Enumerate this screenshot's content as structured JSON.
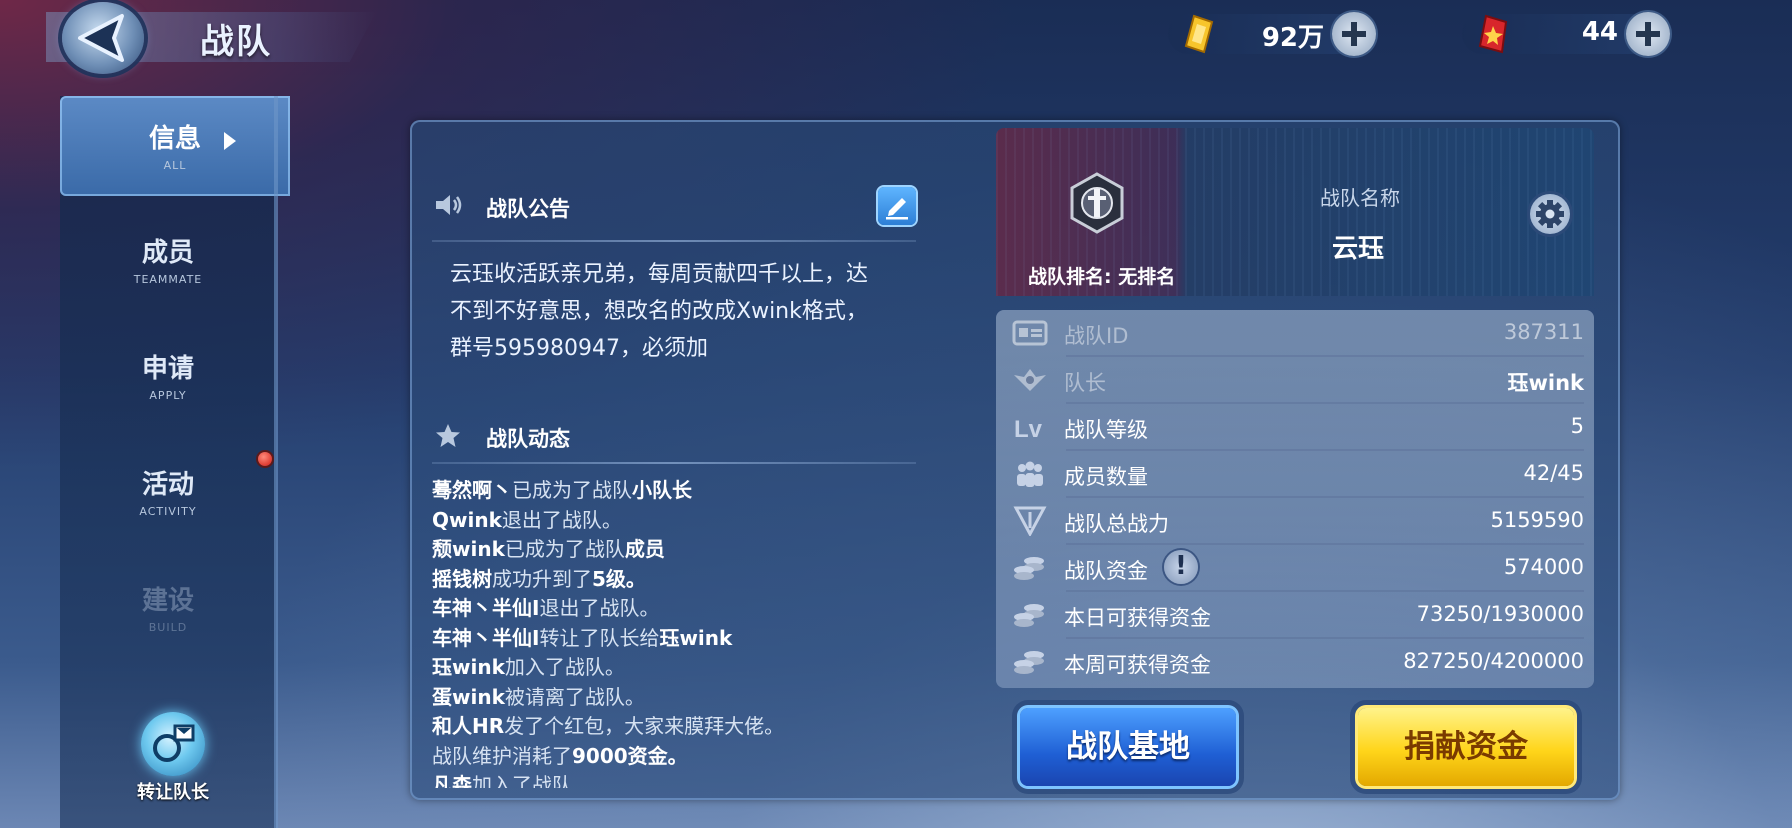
{
  "header": {
    "title": "战队"
  },
  "currencies": {
    "gold": "92万",
    "gems": "44"
  },
  "sidebar": {
    "items": [
      {
        "label": "信息",
        "sub": "ALL"
      },
      {
        "label": "成员",
        "sub": "TEAMMATE"
      },
      {
        "label": "申请",
        "sub": "APPLY"
      },
      {
        "label": "活动",
        "sub": "ACTIVITY"
      },
      {
        "label": "建设",
        "sub": "BUILD"
      }
    ],
    "transfer_label": "转让队长"
  },
  "notice": {
    "title": "战队公告",
    "lines": [
      "云珏收活跃亲兄弟，每周贡献四千以上，达",
      "不到不好意思，想改名的改成Xwink格式，",
      "群号595980947，必须加"
    ]
  },
  "feed": {
    "title": "战队动态",
    "rows": [
      {
        "name": "蓦然啊丶",
        "text": "已成为了战队",
        "extra": "小队长"
      },
      {
        "name": "Qwink",
        "text": "退出了战队。",
        "extra": ""
      },
      {
        "name": "颓wink",
        "text": "已成为了战队",
        "extra": "成员"
      },
      {
        "name": "摇钱树",
        "text": "成功升到了",
        "extra": "5级。"
      },
      {
        "name": "车神丶半仙I",
        "text": "退出了战队。",
        "extra": ""
      },
      {
        "name": "车神丶半仙I",
        "text": "转让了队长给",
        "extra": "珏wink"
      },
      {
        "name": "珏wink",
        "text": "加入了战队。",
        "extra": ""
      },
      {
        "name": "蛋wink",
        "text": "被请离了战队。",
        "extra": ""
      },
      {
        "name": "和人HR",
        "text": "发了个红包，大家来膜拜大佬。",
        "extra": ""
      },
      {
        "name": "",
        "text": "战队维护消耗了",
        "extra": "9000资金。"
      },
      {
        "name": "凡森",
        "text": "加入了战队",
        "extra": ""
      }
    ]
  },
  "team": {
    "rank_label": "战队排名:",
    "rank_value": "无排名",
    "name_label": "战队名称",
    "name": "云珏"
  },
  "stats": [
    {
      "icon": "id-card-icon",
      "label": "战队ID",
      "value": "387311",
      "style": "dim"
    },
    {
      "icon": "captain-wings-icon",
      "label": "队长",
      "value": "珏wink",
      "style": "dim"
    },
    {
      "icon": "level-icon",
      "label": "战队等级",
      "value": "5",
      "style": "bright"
    },
    {
      "icon": "members-icon",
      "label": "成员数量",
      "value": "42/45",
      "style": "bright"
    },
    {
      "icon": "power-icon",
      "label": "战队总战力",
      "value": "5159590",
      "style": "bright"
    },
    {
      "icon": "coins-icon",
      "label": "战队资金",
      "value": "574000",
      "style": "bright"
    },
    {
      "icon": "coins-icon",
      "label": "本日可获得资金",
      "value": "73250/1930000",
      "style": "bright"
    },
    {
      "icon": "coins-icon",
      "label": "本周可获得资金",
      "value": "827250/4200000",
      "style": "bright"
    }
  ],
  "buttons": {
    "base": "战队基地",
    "donate": "捐献资金"
  }
}
